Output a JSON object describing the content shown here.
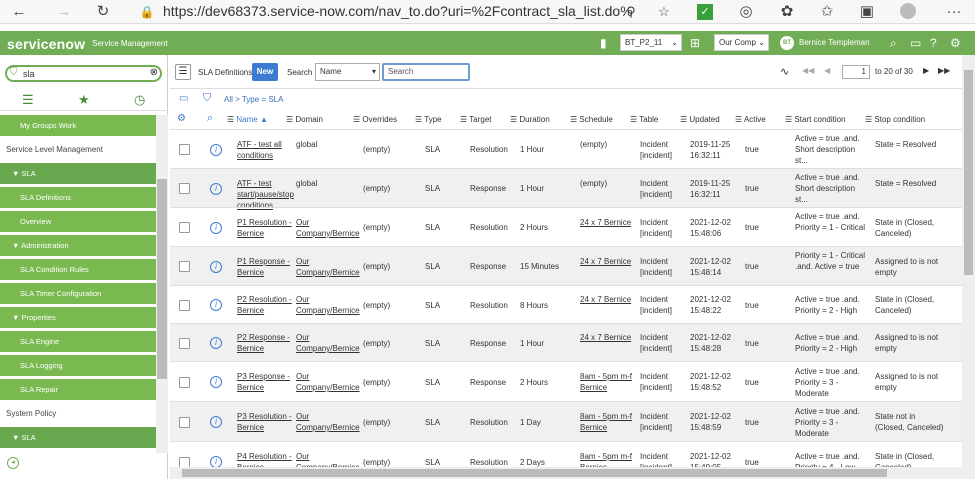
{
  "browser": {
    "url": "https://dev68373.service-now.com/nav_to.do?uri=%2Fcontract_sla_list.do%3Fs..."
  },
  "header": {
    "logo": "servicenow",
    "product": "Service Management",
    "update_set": "BT_P2_11",
    "company": "Our Comp",
    "user_initials": "BT",
    "user_name": "Bernice Templeman"
  },
  "sidebar": {
    "filter_value": "sla",
    "items": [
      {
        "label": "My Groups Work",
        "style": "item"
      },
      {
        "label": "Service Level Management",
        "style": "plain"
      },
      {
        "label": "▼ SLA",
        "style": "sel"
      },
      {
        "label": "SLA Definitions",
        "style": "item"
      },
      {
        "label": "Overview",
        "style": "item"
      },
      {
        "label": "▼ Administration",
        "style": "item"
      },
      {
        "label": "SLA Condition Rules",
        "style": "item"
      },
      {
        "label": "SLA Timer Configuration",
        "style": "item"
      },
      {
        "label": "▼ Properties",
        "style": "item"
      },
      {
        "label": "SLA Engine",
        "style": "item"
      },
      {
        "label": "SLA Logging",
        "style": "item"
      },
      {
        "label": "SLA Repair",
        "style": "item"
      },
      {
        "label": "System Policy",
        "style": "plain"
      },
      {
        "label": "▼ SLA",
        "style": "sel"
      }
    ]
  },
  "list": {
    "title": "SLA Definitions",
    "new_label": "New",
    "search_label": "Search",
    "search_field": "Name",
    "search_placeholder": "Search",
    "page_value": "1",
    "page_range": "to 20 of 30",
    "breadcrumb": "All > Type = SLA"
  },
  "columns": [
    "Name ▲",
    "Domain",
    "Overrides",
    "Type",
    "Target",
    "Duration",
    "Schedule",
    "Table",
    "Updated",
    "Active",
    "Start condition",
    "Stop condition"
  ],
  "rows": [
    {
      "name": "ATF - test all conditions",
      "domain": "global",
      "overrides": "(empty)",
      "type": "SLA",
      "target": "Resolution",
      "duration": "1 Hour",
      "schedule": "(empty)",
      "table": "Incident [incident]",
      "updated": "2019-11-25 16:32:11",
      "active": "true",
      "start": "Active = true .and. Short description st...",
      "stop": "State = Resolved"
    },
    {
      "name": "ATF - test start/pause/stop conditions",
      "domain": "global",
      "overrides": "(empty)",
      "type": "SLA",
      "target": "Response",
      "duration": "1 Hour",
      "schedule": "(empty)",
      "table": "Incident [incident]",
      "updated": "2019-11-25 16:32:11",
      "active": "true",
      "start": "Active = true .and. Short description st...",
      "stop": "State = Resolved"
    },
    {
      "name": "P1 Resolution - Bernice",
      "domain": "Our Company/Bernice",
      "overrides": "(empty)",
      "type": "SLA",
      "target": "Resolution",
      "duration": "2 Hours",
      "schedule": "24 x 7 Bernice",
      "table": "Incident [incident]",
      "updated": "2021-12-02 15:48:06",
      "active": "true",
      "start": "Active = true .and. Priority = 1 - Critical",
      "stop": "State in (Closed, Canceled)"
    },
    {
      "name": "P1 Response - Bernice",
      "domain": "Our Company/Bernice",
      "overrides": "(empty)",
      "type": "SLA",
      "target": "Response",
      "duration": "15 Minutes",
      "schedule": "24 x 7 Bernice",
      "table": "Incident [incident]",
      "updated": "2021-12-02 15:48:14",
      "active": "true",
      "start": "Priority = 1 - Critical .and. Active = true",
      "stop": "Assigned to is not empty"
    },
    {
      "name": "P2 Resolution - Bernice",
      "domain": "Our Company/Bernice",
      "overrides": "(empty)",
      "type": "SLA",
      "target": "Resolution",
      "duration": "8 Hours",
      "schedule": "24 x 7 Bernice",
      "table": "Incident [incident]",
      "updated": "2021-12-02 15:48:22",
      "active": "true",
      "start": "Active = true .and. Priority = 2 - High",
      "stop": "State in (Closed, Canceled)"
    },
    {
      "name": "P2 Response - Bernice",
      "domain": "Our Company/Bernice",
      "overrides": "(empty)",
      "type": "SLA",
      "target": "Response",
      "duration": "1 Hour",
      "schedule": "24 x 7 Bernice",
      "table": "Incident [incident]",
      "updated": "2021-12-02 15:48:28",
      "active": "true",
      "start": "Active = true .and. Priority = 2 - High",
      "stop": "Assigned to is not empty"
    },
    {
      "name": "P3 Response - Bernice",
      "domain": "Our Company/Bernice",
      "overrides": "(empty)",
      "type": "SLA",
      "target": "Response",
      "duration": "2 Hours",
      "schedule": "8am - 5pm m-f Bernice",
      "table": "Incident [incident]",
      "updated": "2021-12-02 15:48:52",
      "active": "true",
      "start": "Active = true .and. Priority = 3 - Moderate",
      "stop": "Assigned to is not empty"
    },
    {
      "name": "P3 Resolution - Bernice",
      "domain": "Our Company/Bernice",
      "overrides": "(empty)",
      "type": "SLA",
      "target": "Resolution",
      "duration": "1 Day",
      "schedule": "8am - 5pm m-f Bernice",
      "table": "Incident [incident]",
      "updated": "2021-12-02 15:48:59",
      "active": "true",
      "start": "Active = true .and. Priority = 3 - Moderate",
      "stop": "State not in (Closed, Canceled)"
    },
    {
      "name": "P4 Resolution - Bernice",
      "domain": "Our Company/Bernice",
      "overrides": "(empty)",
      "type": "SLA",
      "target": "Resolution",
      "duration": "2 Days",
      "schedule": "8am - 5pm m-f Bernice",
      "table": "Incident [incident]",
      "updated": "2021-12-02 15:49:05",
      "active": "true",
      "start": "Active = true .and. Priority = 4 - Low",
      "stop": "State in (Closed, Canceled)"
    }
  ],
  "colors": {
    "brand": "#71ad55",
    "link": "#3c7bd1"
  }
}
